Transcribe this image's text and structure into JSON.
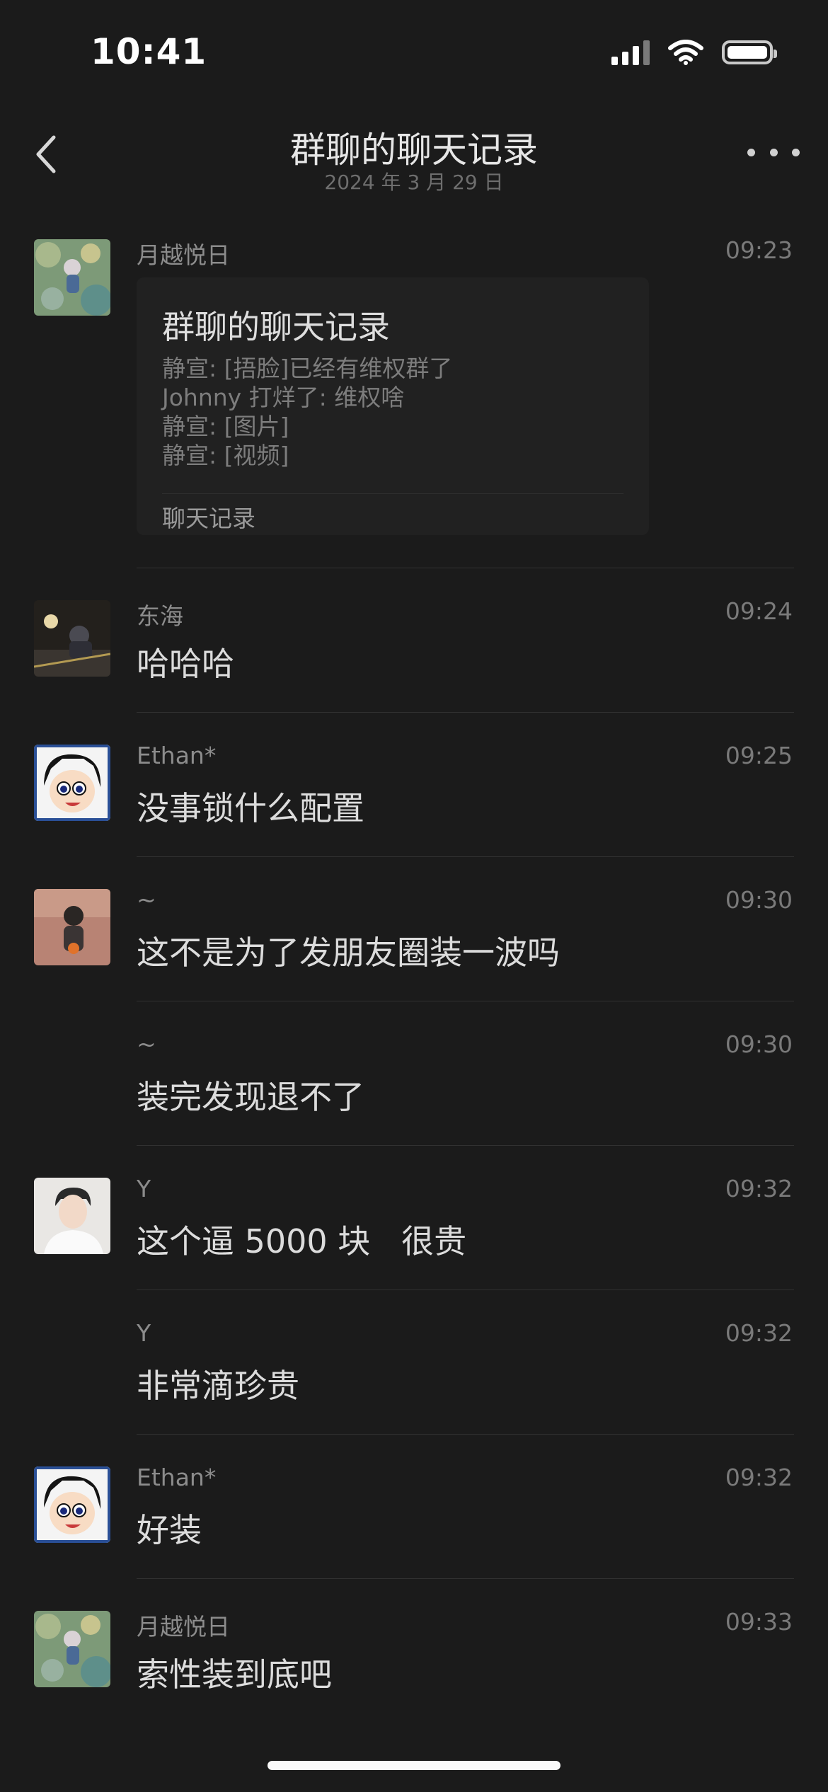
{
  "status": {
    "time": "10:41"
  },
  "header": {
    "title": "群聊的聊天记录",
    "date": "2024 年 3 月 29 日"
  },
  "card": {
    "title": "群聊的聊天记录",
    "lines": [
      "静宣: [捂脸]已经有维权群了",
      "Johnny 打烊了: 维权啥",
      "静宣: [图片]",
      "静宣: [视频]"
    ],
    "footer": "聊天记录"
  },
  "messages": [
    {
      "sender": "月越悦日",
      "time": "09:23"
    },
    {
      "sender": "东海",
      "time": "09:24",
      "text": "哈哈哈"
    },
    {
      "sender": "Ethan*",
      "time": "09:25",
      "text": "没事锁什么配置"
    },
    {
      "sender": "~",
      "time": "09:30",
      "text": "这不是为了发朋友圈装一波吗"
    },
    {
      "sender": "~",
      "time": "09:30",
      "text": "装完发现退不了"
    },
    {
      "sender": "Y",
      "time": "09:32",
      "text": "这个逼 5000 块   很贵"
    },
    {
      "sender": "Y",
      "time": "09:32",
      "text": "非常滴珍贵"
    },
    {
      "sender": "Ethan*",
      "time": "09:32",
      "text": "好装"
    },
    {
      "sender": "月越悦日",
      "time": "09:33",
      "text": "索性装到底吧"
    }
  ],
  "icons": {
    "back": "chevron-left-icon",
    "more": "more-dots-icon",
    "signal": "cellular-signal-icon",
    "wifi": "wifi-icon",
    "battery": "battery-icon"
  }
}
